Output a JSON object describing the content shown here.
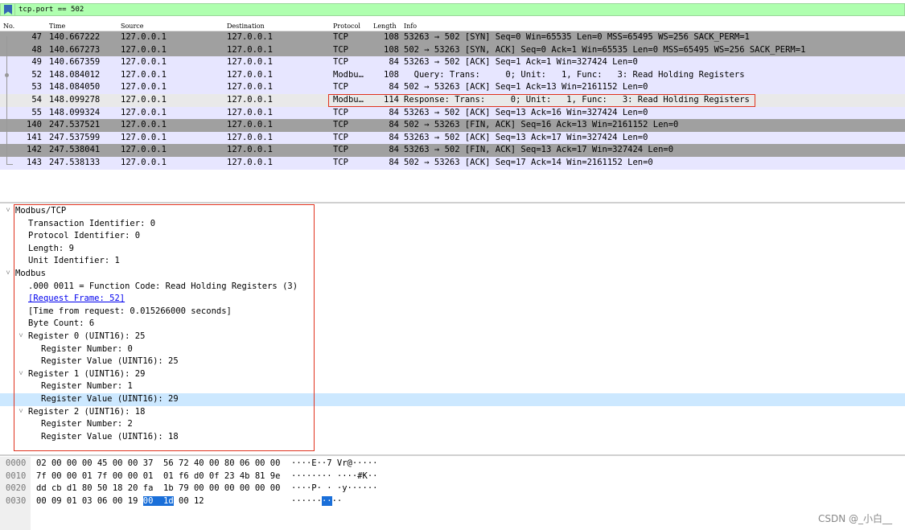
{
  "filter": {
    "value": "tcp.port == 502"
  },
  "columns": [
    "No.",
    "Time",
    "Source",
    "Destination",
    "Protocol",
    "Length",
    "Info"
  ],
  "packets": [
    {
      "no": "47",
      "time": "140.667222",
      "src": "127.0.0.1",
      "dst": "127.0.0.1",
      "proto": "TCP",
      "len": "108",
      "info": "53263 → 502 [SYN] Seq=0 Win=65535 Len=0 MSS=65495 WS=256 SACK_PERM=1",
      "style": "dark"
    },
    {
      "no": "48",
      "time": "140.667273",
      "src": "127.0.0.1",
      "dst": "127.0.0.1",
      "proto": "TCP",
      "len": "108",
      "info": "502 → 53263 [SYN, ACK] Seq=0 Ack=1 Win=65535 Len=0 MSS=65495 WS=256 SACK_PERM=1",
      "style": "dark"
    },
    {
      "no": "49",
      "time": "140.667359",
      "src": "127.0.0.1",
      "dst": "127.0.0.1",
      "proto": "TCP",
      "len": "84",
      "info": "53263 → 502 [ACK] Seq=1 Ack=1 Win=327424 Len=0",
      "style": "light"
    },
    {
      "no": "52",
      "time": "148.084012",
      "src": "127.0.0.1",
      "dst": "127.0.0.1",
      "proto": "Modbu…",
      "len": "108",
      "info": "  Query: Trans:     0; Unit:   1, Func:   3: Read Holding Registers",
      "style": "light"
    },
    {
      "no": "53",
      "time": "148.084050",
      "src": "127.0.0.1",
      "dst": "127.0.0.1",
      "proto": "TCP",
      "len": "84",
      "info": "502 → 53263 [ACK] Seq=1 Ack=13 Win=2161152 Len=0",
      "style": "light"
    },
    {
      "no": "54",
      "time": "148.099278",
      "src": "127.0.0.1",
      "dst": "127.0.0.1",
      "proto": "Modbu…",
      "len": "114",
      "info": "Response: Trans:     0; Unit:   1, Func:   3: Read Holding Registers",
      "style": "sel"
    },
    {
      "no": "55",
      "time": "148.099324",
      "src": "127.0.0.1",
      "dst": "127.0.0.1",
      "proto": "TCP",
      "len": "84",
      "info": "53263 → 502 [ACK] Seq=13 Ack=16 Win=327424 Len=0",
      "style": "light"
    },
    {
      "no": "140",
      "time": "247.537521",
      "src": "127.0.0.1",
      "dst": "127.0.0.1",
      "proto": "TCP",
      "len": "84",
      "info": "502 → 53263 [FIN, ACK] Seq=16 Ack=13 Win=2161152 Len=0",
      "style": "dark"
    },
    {
      "no": "141",
      "time": "247.537599",
      "src": "127.0.0.1",
      "dst": "127.0.0.1",
      "proto": "TCP",
      "len": "84",
      "info": "53263 → 502 [ACK] Seq=13 Ack=17 Win=327424 Len=0",
      "style": "light"
    },
    {
      "no": "142",
      "time": "247.538041",
      "src": "127.0.0.1",
      "dst": "127.0.0.1",
      "proto": "TCP",
      "len": "84",
      "info": "53263 → 502 [FIN, ACK] Seq=13 Ack=17 Win=327424 Len=0",
      "style": "dark"
    },
    {
      "no": "143",
      "time": "247.538133",
      "src": "127.0.0.1",
      "dst": "127.0.0.1",
      "proto": "TCP",
      "len": "84",
      "info": "502 → 53263 [ACK] Seq=17 Ack=14 Win=2161152 Len=0",
      "style": "light"
    }
  ],
  "details": [
    {
      "level": 0,
      "expander": "open",
      "text": "Modbus/TCP"
    },
    {
      "level": 1,
      "text": "Transaction Identifier: 0"
    },
    {
      "level": 1,
      "text": "Protocol Identifier: 0"
    },
    {
      "level": 1,
      "text": "Length: 9"
    },
    {
      "level": 1,
      "text": "Unit Identifier: 1"
    },
    {
      "level": 0,
      "expander": "open",
      "text": "Modbus"
    },
    {
      "level": 1,
      "text": ".000 0011 = Function Code: Read Holding Registers (3)"
    },
    {
      "level": 1,
      "text": "[Request Frame: 52]",
      "link": true
    },
    {
      "level": 1,
      "text": "[Time from request: 0.015266000 seconds]"
    },
    {
      "level": 1,
      "text": "Byte Count: 6"
    },
    {
      "level": 1,
      "expander": "open",
      "text": "Register 0 (UINT16): 25"
    },
    {
      "level": 2,
      "text": "Register Number: 0"
    },
    {
      "level": 2,
      "text": "Register Value (UINT16): 25"
    },
    {
      "level": 1,
      "expander": "open",
      "text": "Register 1 (UINT16): 29"
    },
    {
      "level": 2,
      "text": "Register Number: 1"
    },
    {
      "level": 2,
      "text": "Register Value (UINT16): 29",
      "selected": true
    },
    {
      "level": 1,
      "expander": "open",
      "text": "Register 2 (UINT16): 18"
    },
    {
      "level": 2,
      "text": "Register Number: 2"
    },
    {
      "level": 2,
      "text": "Register Value (UINT16): 18"
    }
  ],
  "hex": [
    {
      "off": "0000",
      "bytes": "02 00 00 00 45 00 00 37  56 72 40 00 80 06 00 00",
      "ascii": "····E··7 Vr@·····"
    },
    {
      "off": "0010",
      "bytes": "7f 00 00 01 7f 00 00 01  01 f6 d0 0f 23 4b 81 9e",
      "ascii": "········ ····#K··"
    },
    {
      "off": "0020",
      "bytes": "dd cb d1 80 50 18 20 fa  1b 79 00 00 00 00 00 00",
      "ascii": "····P· · ·y······"
    },
    {
      "off": "0030",
      "bytes_pre": "00 09 01 03 06 00 19 ",
      "bytes_sel": "00  1d",
      "bytes_post": " 00 12",
      "ascii_pre": "······",
      "ascii_sel": "··",
      "ascii_post": "··"
    }
  ],
  "watermark": "CSDN @_小白__",
  "colors": {
    "filter_bg": "#afffaf",
    "row_dark": "#a0a0a0",
    "row_light": "#e7e6ff",
    "selected": "#cce8ff",
    "highlight_box": "#e0321e",
    "hex_sel": "#1a6fd9"
  }
}
